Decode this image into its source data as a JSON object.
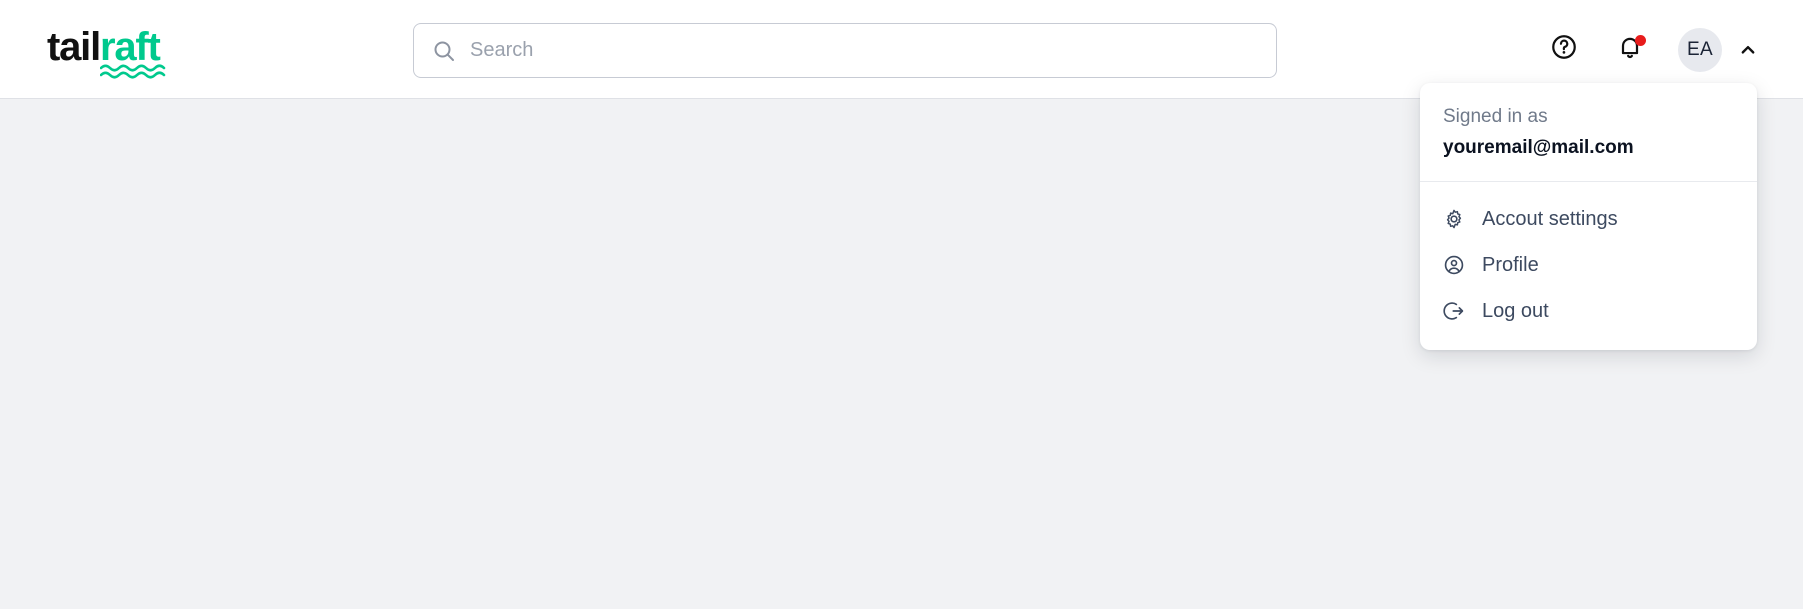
{
  "brand": {
    "name_part_one": "tail",
    "name_part_two": "raft",
    "accent_color": "#00c98d",
    "dark_color": "#111111"
  },
  "search": {
    "placeholder": "Search",
    "value": ""
  },
  "header": {
    "help_icon": "help-circle-icon",
    "notifications_icon": "bell-icon",
    "notification_dot_color": "#e81c1c",
    "avatar_initials": "EA",
    "chevron_icon": "chevron-up-icon"
  },
  "account_menu": {
    "signed_in_label": "Signed in as",
    "email": "youremail@mail.com",
    "items": [
      {
        "label": "Accout settings",
        "icon": "gear-icon"
      },
      {
        "label": "Profile",
        "icon": "user-circle-icon"
      },
      {
        "label": "Log out",
        "icon": "logout-icon"
      }
    ]
  }
}
